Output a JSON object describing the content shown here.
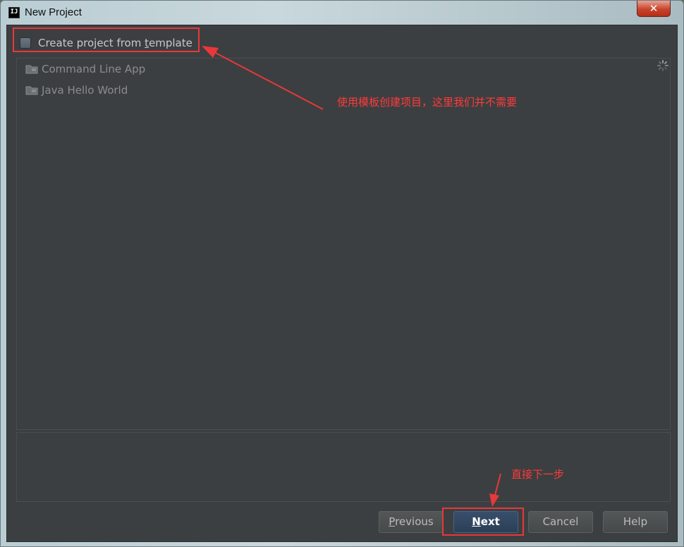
{
  "window": {
    "title": "New Project",
    "app_icon_text": "IJ",
    "close_symbol": "✕"
  },
  "template_option": {
    "label_before": "Create project from ",
    "label_underlined": "t",
    "label_after": "emplate",
    "checked": false
  },
  "templates": [
    {
      "label": "Command Line App",
      "icon": "folder-icon"
    },
    {
      "label": "Java Hello World",
      "icon": "folder-icon"
    }
  ],
  "buttons": {
    "previous": {
      "underlined": "P",
      "rest": "revious",
      "enabled": false
    },
    "next": {
      "underlined": "N",
      "rest": "ext"
    },
    "cancel": {
      "label": "Cancel"
    },
    "help": {
      "label": "Help"
    }
  },
  "annotations": {
    "template_note": "使用模板创建项目，这里我们并不需要",
    "next_note": "直接下一步"
  },
  "colors": {
    "panel_bg": "#3c3f41",
    "annotation_red": "#e8383a",
    "next_button": "#2c3f57"
  }
}
